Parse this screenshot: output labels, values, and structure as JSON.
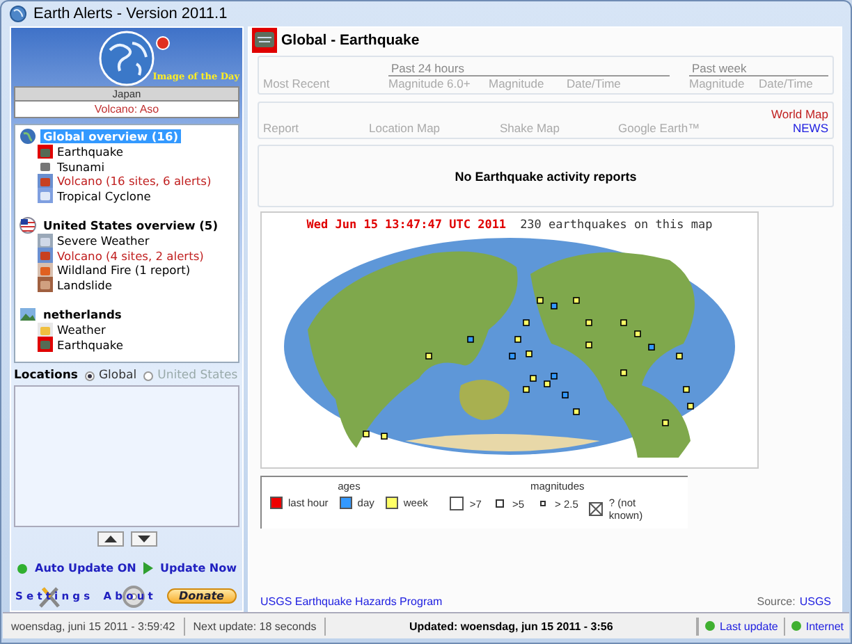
{
  "window": {
    "title": "Earth Alerts - Version 2011.1"
  },
  "image_of_day": {
    "caption": "Image of the Day",
    "location": "Japan",
    "subject": "Volcano: Aso"
  },
  "tree": [
    {
      "label": "Global overview (16)",
      "kind": "globe",
      "selected": true,
      "children": [
        {
          "label": "Earthquake",
          "kind": "earthquake",
          "alert": false
        },
        {
          "label": "Tsunami",
          "kind": "tsunami",
          "alert": false
        },
        {
          "label": "Volcano (16 sites, 6 alerts)",
          "kind": "volcano",
          "alert": true
        },
        {
          "label": "Tropical Cyclone",
          "kind": "cyclone",
          "alert": false
        }
      ]
    },
    {
      "label": "United States overview (5)",
      "kind": "flag",
      "selected": false,
      "children": [
        {
          "label": "Severe Weather",
          "kind": "storm",
          "alert": false
        },
        {
          "label": "Volcano (4 sites, 2 alerts)",
          "kind": "volcano",
          "alert": true
        },
        {
          "label": "Wildland Fire (1 report)",
          "kind": "fire",
          "alert": false
        },
        {
          "label": "Landslide",
          "kind": "landslide",
          "alert": false
        }
      ]
    },
    {
      "label": "netherlands",
      "kind": "landscape",
      "selected": false,
      "children": [
        {
          "label": "Weather",
          "kind": "weather",
          "alert": false
        },
        {
          "label": "Earthquake",
          "kind": "earthquake",
          "alert": false
        }
      ]
    }
  ],
  "locations": {
    "label": "Locations",
    "options": [
      {
        "label": "Global",
        "selected": true,
        "disabled": false
      },
      {
        "label": "United States",
        "selected": false,
        "disabled": true
      }
    ]
  },
  "auto_update": {
    "label": "Auto Update ON",
    "on": true
  },
  "update_now": "Update Now",
  "settings": "Settings",
  "about": "About",
  "donate": "Donate",
  "header": {
    "title": "Global - Earthquake"
  },
  "summary": {
    "most_recent": "Most Recent",
    "past_24h": {
      "heading": "Past 24 hours",
      "columns": [
        "Magnitude 6.0+",
        "Magnitude",
        "Date/Time"
      ]
    },
    "past_week": {
      "heading": "Past week",
      "columns": [
        "Magnitude",
        "Date/Time"
      ]
    }
  },
  "links": [
    "Report",
    "Location Map",
    "Shake Map",
    "Google Earth™"
  ],
  "world_map": "World Map",
  "news": "NEWS",
  "message": "No Earthquake activity reports",
  "map": {
    "timestamp": "Wed Jun 15 13:47:47 UTC 2011",
    "count": "230 earthquakes on this map"
  },
  "legend": {
    "ages_heading": "ages",
    "ages": [
      {
        "label": "last hour",
        "color": "#ee0000"
      },
      {
        "label": "day",
        "color": "#3399ff"
      },
      {
        "label": "week",
        "color": "#ffff66"
      }
    ],
    "magnitudes_heading": "magnitudes",
    "magnitudes": [
      {
        "label": ">7",
        "kind": "large"
      },
      {
        "label": ">5",
        "kind": "medium"
      },
      {
        "label": "> 2.5",
        "kind": "small"
      },
      {
        "label": "? (not known)",
        "kind": "unknown"
      }
    ]
  },
  "footer": {
    "program_link": "USGS Earthquake Hazards Program",
    "source_label": "Source:",
    "source_link": "USGS"
  },
  "status": {
    "clock": "woensdag, juni 15 2011 - 3:59:42",
    "next_update": "Next update: 18 seconds",
    "updated": "Updated: woensdag, jun 15 2011 - 3:56",
    "indicators": [
      {
        "label": "Last update",
        "on": true
      },
      {
        "label": "Internet",
        "on": true
      }
    ]
  }
}
